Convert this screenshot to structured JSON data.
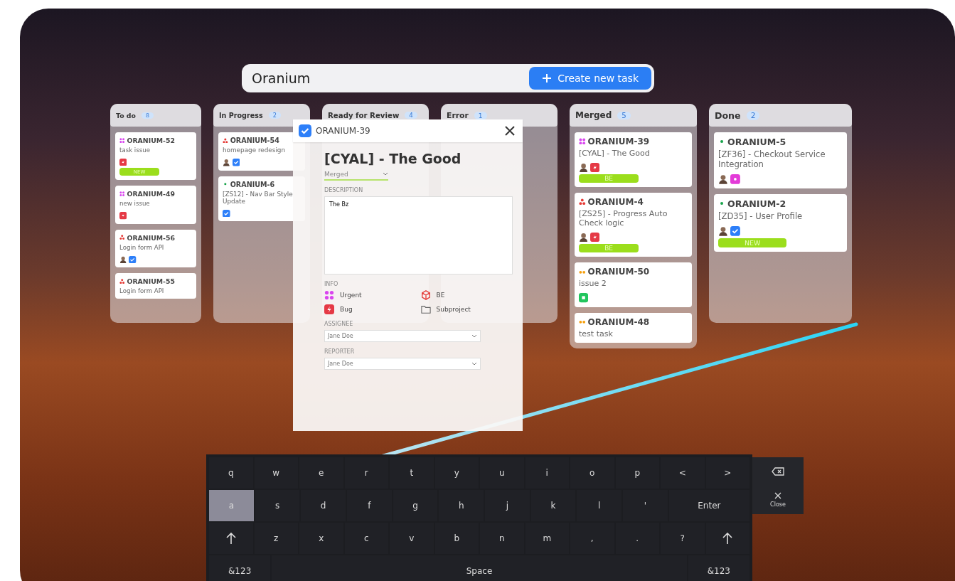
{
  "board": {
    "title": "Oranium",
    "create_button": "Create new task"
  },
  "columns": [
    {
      "name": "To do",
      "count": "8",
      "cards": [
        {
          "key": "ORANIUM-52",
          "priority_icon": {
            "kind": "urgent"
          },
          "title": "task issue",
          "avatar": false,
          "type_icon": {
            "kind": "bug"
          },
          "tag": "NEW"
        },
        {
          "key": "ORANIUM-49",
          "priority_icon": {
            "kind": "urgent"
          },
          "title": "new issue",
          "avatar": false,
          "type_icon": {
            "kind": "bug"
          }
        },
        {
          "key": "ORANIUM-56",
          "priority_icon": {
            "kind": "high"
          },
          "title": "Login form API",
          "avatar": true,
          "type_icon": {
            "kind": "task"
          }
        },
        {
          "key": "ORANIUM-55",
          "priority_icon": {
            "kind": "high"
          },
          "title": "Login form API",
          "avatar": false
        }
      ]
    },
    {
      "name": "In Progress",
      "count": "2",
      "cards": [
        {
          "key": "ORANIUM-54",
          "priority_icon": {
            "kind": "high"
          },
          "title": "homepage redesign",
          "avatar": true,
          "type_icon": {
            "kind": "task"
          }
        },
        {
          "key": "ORANIUM-6",
          "priority_icon": {
            "kind": "low"
          },
          "title": "[ZS12] - Nav Bar Style Update",
          "avatar": false,
          "type_icon": {
            "kind": "task"
          }
        }
      ]
    },
    {
      "name": "Ready for Review",
      "count": "4"
    },
    {
      "name": "Error",
      "count": "1"
    },
    {
      "name": "Merged",
      "count": "5",
      "cards": [
        {
          "key": "ORANIUM-39",
          "priority_icon": {
            "kind": "urgent"
          },
          "title": "[CYAL] - The Good",
          "avatar": true,
          "type_icon": {
            "kind": "bug"
          },
          "tag": "BE"
        },
        {
          "key": "ORANIUM-4",
          "priority_icon": {
            "kind": "high"
          },
          "title": "[ZS25] - Progress Auto Check logic",
          "avatar": true,
          "type_icon": {
            "kind": "bug"
          },
          "tag": "BE"
        },
        {
          "key": "ORANIUM-50",
          "priority_icon": {
            "kind": "medium"
          },
          "title": "issue 2",
          "avatar": false,
          "type_icon": {
            "kind": "story"
          }
        },
        {
          "key": "ORANIUM-48",
          "priority_icon": {
            "kind": "medium"
          },
          "title": "test task",
          "avatar": false
        }
      ]
    },
    {
      "name": "Done",
      "count": "2",
      "cards": [
        {
          "key": "ORANIUM-5",
          "priority_icon": {
            "kind": "low"
          },
          "title": "[ZF36] - Checkout Service Integration",
          "avatar": true,
          "type_icon": {
            "kind": "question"
          }
        },
        {
          "key": "ORANIUM-2",
          "priority_icon": {
            "kind": "low"
          },
          "title": "[ZD35] - User Profile",
          "avatar": true,
          "type_icon": {
            "kind": "task"
          },
          "tag": "NEW"
        }
      ]
    }
  ],
  "task_dialog": {
    "key": "ORANIUM-39",
    "title": "[CYAL] - The Good",
    "status": "Merged",
    "description_label": "DESCRIPTION",
    "description": "The Bz",
    "info_label": "INFO",
    "info": [
      {
        "kind": "priority",
        "label": "Urgent"
      },
      {
        "kind": "component",
        "label": "BE"
      },
      {
        "kind": "type",
        "label": "Bug"
      },
      {
        "kind": "project",
        "label": "Subproject"
      }
    ],
    "assignee_label": "ASSIGNEE",
    "assignee": "Jane Doe",
    "reporter_label": "REPORTER",
    "reporter": "Jane Doe"
  },
  "keyboard": {
    "rows": [
      [
        {
          "kind": "char",
          "label": "q",
          "selected": false
        },
        {
          "kind": "char",
          "label": "w",
          "selected": false
        },
        {
          "kind": "char",
          "label": "e",
          "selected": false
        },
        {
          "kind": "char",
          "label": "r",
          "selected": false
        },
        {
          "kind": "char",
          "label": "t",
          "selected": false
        },
        {
          "kind": "char",
          "label": "y",
          "selected": false
        },
        {
          "kind": "char",
          "label": "u",
          "selected": false
        },
        {
          "kind": "char",
          "label": "i",
          "selected": false
        },
        {
          "kind": "char",
          "label": "o",
          "selected": false
        },
        {
          "kind": "char",
          "label": "p",
          "selected": false
        },
        {
          "kind": "char",
          "label": "<",
          "selected": false
        },
        {
          "kind": "char",
          "label": ">",
          "selected": false
        }
      ],
      [
        {
          "kind": "char",
          "label": "a",
          "selected": true
        },
        {
          "kind": "char",
          "label": "s",
          "selected": false
        },
        {
          "kind": "char",
          "label": "d",
          "selected": false
        },
        {
          "kind": "char",
          "label": "f",
          "selected": false
        },
        {
          "kind": "char",
          "label": "g",
          "selected": false
        },
        {
          "kind": "char",
          "label": "h",
          "selected": false
        },
        {
          "kind": "char",
          "label": "j",
          "selected": false
        },
        {
          "kind": "char",
          "label": "k",
          "selected": false
        },
        {
          "kind": "char",
          "label": "l",
          "selected": false
        },
        {
          "kind": "char",
          "label": "'",
          "selected": false
        },
        {
          "kind": "enter",
          "label": "Enter",
          "selected": false
        }
      ],
      [
        {
          "kind": "shift",
          "selected": false
        },
        {
          "kind": "char",
          "label": "z",
          "selected": false
        },
        {
          "kind": "char",
          "label": "x",
          "selected": false
        },
        {
          "kind": "char",
          "label": "c",
          "selected": false
        },
        {
          "kind": "char",
          "label": "v",
          "selected": false
        },
        {
          "kind": "char",
          "label": "b",
          "selected": false
        },
        {
          "kind": "char",
          "label": "n",
          "selected": false
        },
        {
          "kind": "char",
          "label": "m",
          "selected": false
        },
        {
          "kind": "char",
          "label": ",",
          "selected": false
        },
        {
          "kind": "char",
          "label": ".",
          "selected": false
        },
        {
          "kind": "char",
          "label": "?",
          "selected": false
        },
        {
          "kind": "shift",
          "selected": false
        }
      ]
    ],
    "bottom_keys": [
      {
        "kind": "mode",
        "label": "&123",
        "selected": false
      },
      {
        "kind": "space",
        "label": "Space",
        "selected": false
      },
      {
        "kind": "mode",
        "label": "&123",
        "selected": false
      }
    ],
    "side_keys": [
      {
        "kind": "backspace",
        "selected": false
      },
      {
        "kind": "close",
        "label": "Close",
        "selected": false
      }
    ]
  }
}
